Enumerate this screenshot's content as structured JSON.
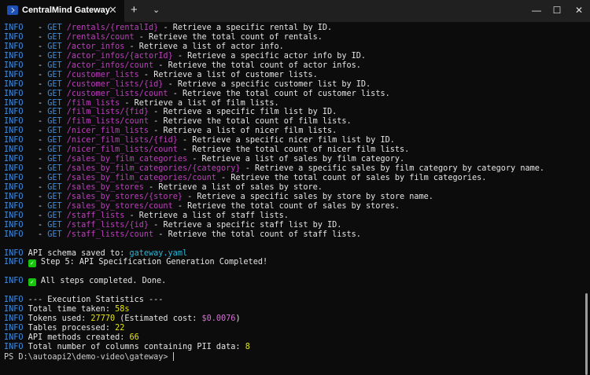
{
  "window": {
    "tab_title": "CentralMind Gateway",
    "tab_close": "✕",
    "new_tab": "+",
    "dropdown": "⌄",
    "minimize": "—",
    "maximize": "☐",
    "close": "✕"
  },
  "routes": [
    {
      "path": "/rentals/{rentalId}",
      "desc": "Retrieve a specific rental by ID."
    },
    {
      "path": "/rentals/count",
      "desc": "Retrieve the total count of rentals."
    },
    {
      "path": "/actor_infos",
      "desc": "Retrieve a list of actor info."
    },
    {
      "path": "/actor_infos/{actorId}",
      "desc": "Retrieve a specific actor info by ID."
    },
    {
      "path": "/actor_infos/count",
      "desc": "Retrieve the total count of actor infos."
    },
    {
      "path": "/customer_lists",
      "desc": "Retrieve a list of customer lists."
    },
    {
      "path": "/customer_lists/{id}",
      "desc": "Retrieve a specific customer list by ID."
    },
    {
      "path": "/customer_lists/count",
      "desc": "Retrieve the total count of customer lists."
    },
    {
      "path": "/film_lists",
      "desc": "Retrieve a list of film lists."
    },
    {
      "path": "/film_lists/{fid}",
      "desc": "Retrieve a specific film list by ID."
    },
    {
      "path": "/film_lists/count",
      "desc": "Retrieve the total count of film lists."
    },
    {
      "path": "/nicer_film_lists",
      "desc": "Retrieve a list of nicer film lists."
    },
    {
      "path": "/nicer_film_lists/{fid}",
      "desc": "Retrieve a specific nicer film list by ID."
    },
    {
      "path": "/nicer_film_lists/count",
      "desc": "Retrieve the total count of nicer film lists."
    },
    {
      "path": "/sales_by_film_categories",
      "desc": "Retrieve a list of sales by film category."
    },
    {
      "path": "/sales_by_film_categories/{category}",
      "desc": "Retrieve a specific sales by film category by category name."
    },
    {
      "path": "/sales_by_film_categories/count",
      "desc": "Retrieve the total count of sales by film categories."
    },
    {
      "path": "/sales_by_stores",
      "desc": "Retrieve a list of sales by store."
    },
    {
      "path": "/sales_by_stores/{store}",
      "desc": "Retrieve a specific sales by store by store name."
    },
    {
      "path": "/sales_by_stores/count",
      "desc": "Retrieve the total count of sales by stores."
    },
    {
      "path": "/staff_lists",
      "desc": "Retrieve a list of staff lists."
    },
    {
      "path": "/staff_lists/{id}",
      "desc": "Retrieve a specific staff list by ID."
    },
    {
      "path": "/staff_lists/count",
      "desc": "Retrieve the total count of staff lists."
    }
  ],
  "log": {
    "info_label": "INFO",
    "route_prefix": "   - ",
    "method": "GET",
    "sep": " - ",
    "schema_saved": " API schema saved to: ",
    "schema_file": "gateway.yaml",
    "step5": " Step 5: API Specification Generation Completed!",
    "all_done": " All steps completed. Done.",
    "stats_header": " --- Execution Statistics ---",
    "time_label": " Total time taken: ",
    "time_value": "58s",
    "tokens_label": " Tokens used: ",
    "tokens_value": "27770",
    "cost_label": " (Estimated cost: ",
    "cost_value": "$0.0076",
    "cost_close": ")",
    "tables_label": " Tables processed: ",
    "tables_value": "22",
    "methods_label": " API methods created: ",
    "methods_value": "66",
    "pii_label": " Total number of columns containing PII data: ",
    "pii_value": "8",
    "check": "✓"
  },
  "prompt": "PS D:\\autoapi2\\demo-video\\gateway> "
}
